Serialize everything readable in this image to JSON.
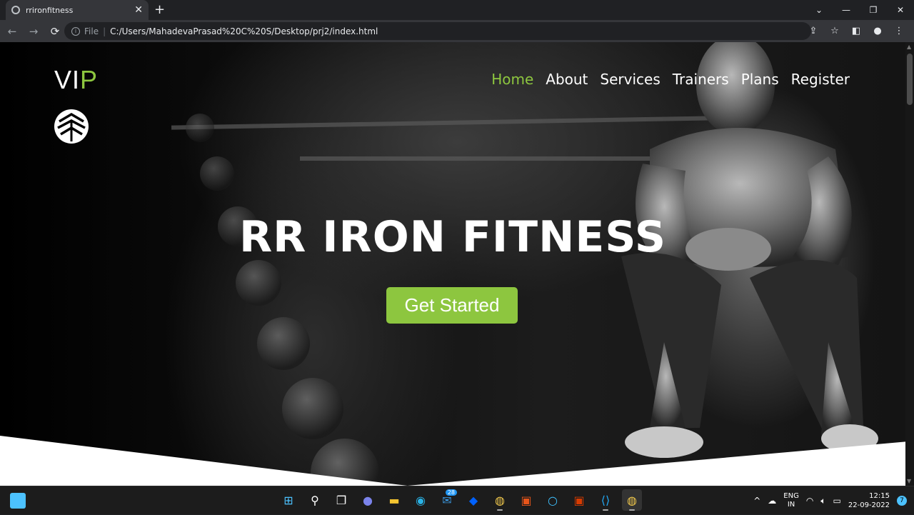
{
  "browser": {
    "tab_title": "rrironfitness",
    "tab_close": "✕",
    "new_tab": "+",
    "window_controls": [
      "⌄",
      "—",
      "❐",
      "✕"
    ],
    "nav": {
      "back": "←",
      "forward": "→",
      "reload": "⟳"
    },
    "address": {
      "scheme_label": "File",
      "separator": "|",
      "url": "C:/Users/MahadevaPrasad%20C%20S/Desktop/prj2/index.html"
    },
    "toolbar_icons": [
      "share-icon",
      "star-icon",
      "sidepanel-icon",
      "profile-icon",
      "menu-icon"
    ],
    "toolbar_glyphs": [
      "⇪",
      "☆",
      "◧",
      "●",
      "⋮"
    ]
  },
  "site": {
    "logo": {
      "text_main": "VI",
      "text_accent": "P"
    },
    "nav": [
      {
        "label": "Home",
        "active": true
      },
      {
        "label": "About",
        "active": false
      },
      {
        "label": "Services",
        "active": false
      },
      {
        "label": "Trainers",
        "active": false
      },
      {
        "label": "Plans",
        "active": false
      },
      {
        "label": "Register",
        "active": false
      }
    ],
    "hero_title": "RR IRON FITNESS",
    "cta_label": "Get Started",
    "colors": {
      "accent": "#8dc63f",
      "text": "#ffffff"
    }
  },
  "taskbar": {
    "icons": [
      "start-icon",
      "search-icon",
      "task-view-icon",
      "teams-chat-icon",
      "file-explorer-icon",
      "edge-icon",
      "mail-icon",
      "dropbox-icon",
      "chrome-icon",
      "office-icon",
      "cortana-icon",
      "office-red-icon",
      "vscode-icon",
      "chrome-active-icon"
    ],
    "mail_badge": "28",
    "tray": {
      "chevron": "^",
      "lang_top": "ENG",
      "lang_bottom": "IN",
      "time": "12:15",
      "date": "22-09-2022",
      "notifications": "7"
    }
  }
}
